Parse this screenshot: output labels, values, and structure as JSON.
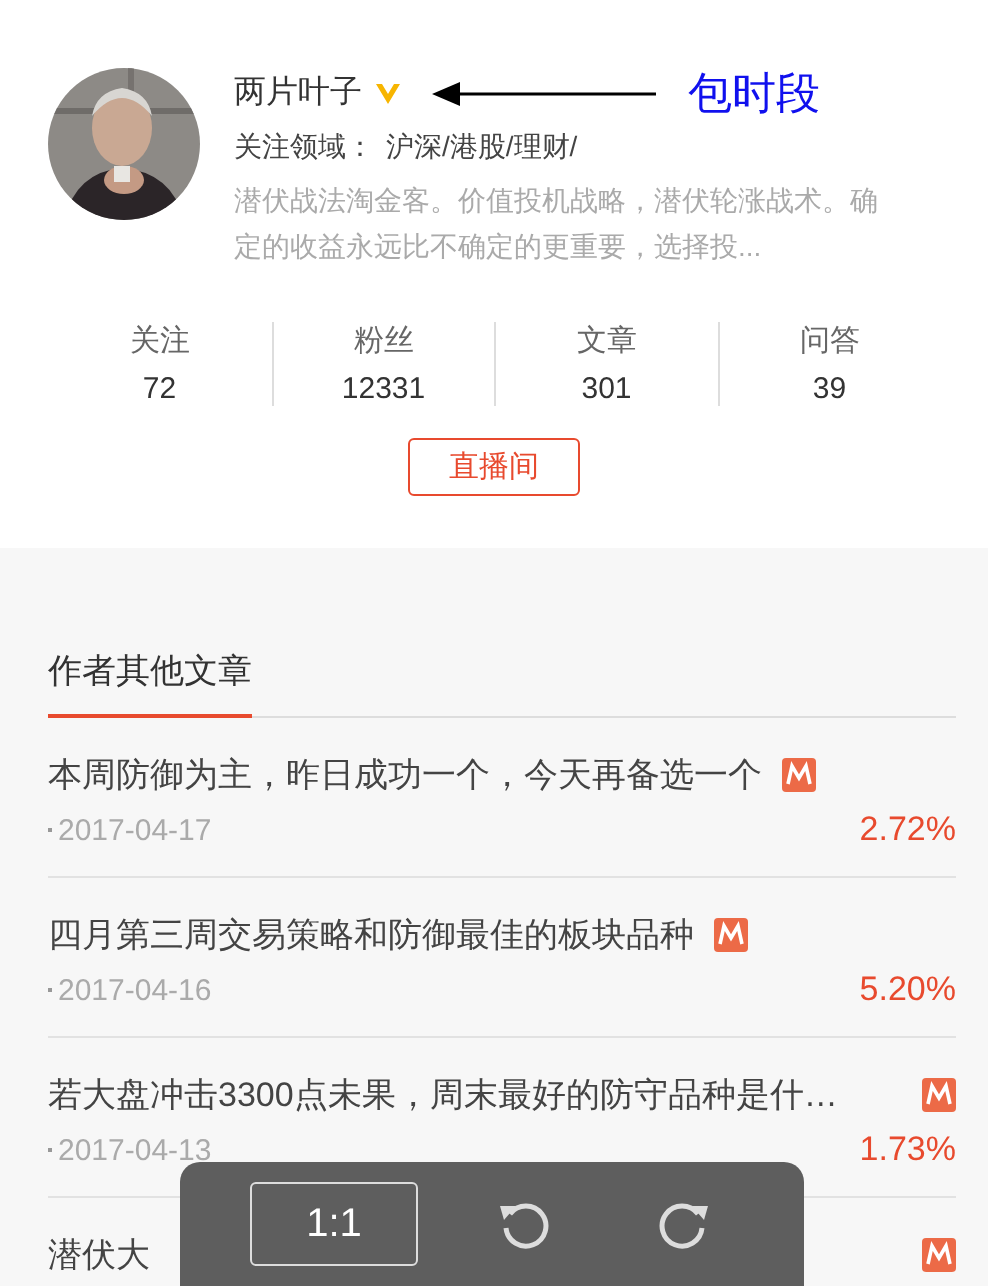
{
  "profile": {
    "name": "两片叶子",
    "field_label": "关注领域：",
    "field_value": "沪深/港股/理财/",
    "bio": "潜伏战法淘金客。价值投机战略，潜伏轮涨战术。确定的收益永远比不确定的更重要，选择投..."
  },
  "annotation": {
    "text": "包时段"
  },
  "stats": [
    {
      "label": "关注",
      "value": "72"
    },
    {
      "label": "粉丝",
      "value": "12331"
    },
    {
      "label": "文章",
      "value": "301"
    },
    {
      "label": "问答",
      "value": "39"
    }
  ],
  "live_button": "直播间",
  "section_title": "作者其他文章",
  "articles": [
    {
      "title": "本周防御为主，昨日成功一个，今天再备选一个",
      "date": "2017-04-17",
      "change": "2.72%"
    },
    {
      "title": "四月第三周交易策略和防御最佳的板块品种",
      "date": "2017-04-16",
      "change": "5.20%"
    },
    {
      "title": "若大盘冲击3300点未果，周末最好的防守品种是什…",
      "date": "2017-04-13",
      "change": "1.73%"
    },
    {
      "title": "潜伏大"
    }
  ],
  "viewer_toolbar": {
    "zoom_button": "1:1"
  }
}
